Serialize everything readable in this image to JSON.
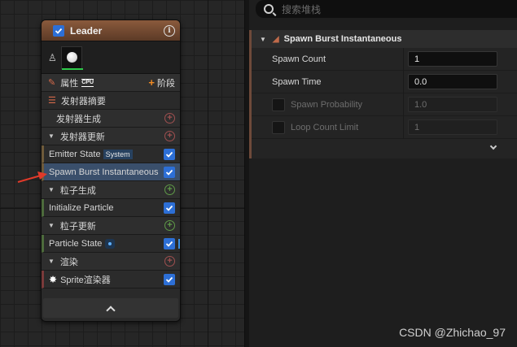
{
  "node": {
    "title": "Leader",
    "properties_label": "属性",
    "cpu_badge": "CPU",
    "add_stage_label": "阶段",
    "rows": {
      "emitter_summary": "发射器摘要",
      "emitter_spawn": "发射器生成",
      "emitter_update": "发射器更新",
      "emitter_state": "Emitter State",
      "emitter_state_tag": "System",
      "spawn_burst": "Spawn Burst Instantaneous",
      "particle_spawn": "粒子生成",
      "initialize_particle": "Initialize Particle",
      "particle_update": "粒子更新",
      "particle_state": "Particle State",
      "render": "渲染",
      "sprite_renderer": "Sprite渲染器"
    }
  },
  "panel": {
    "search_placeholder": "搜索堆栈",
    "module_title": "Spawn Burst Instantaneous",
    "properties": [
      {
        "name": "Spawn Count",
        "value": "1",
        "enabled": true
      },
      {
        "name": "Spawn Time",
        "value": "0.0",
        "enabled": true
      },
      {
        "name": "Spawn Probability",
        "value": "1.0",
        "enabled": false
      },
      {
        "name": "Loop Count Limit",
        "value": "1",
        "enabled": false
      }
    ]
  },
  "watermark": "CSDN @Zhichao_97",
  "colors": {
    "header_brown": "#8a5a3c",
    "selected_row": "#3a4f6b",
    "checkbox_blue": "#2d6fd6",
    "arrow_red": "#e03a2a"
  }
}
